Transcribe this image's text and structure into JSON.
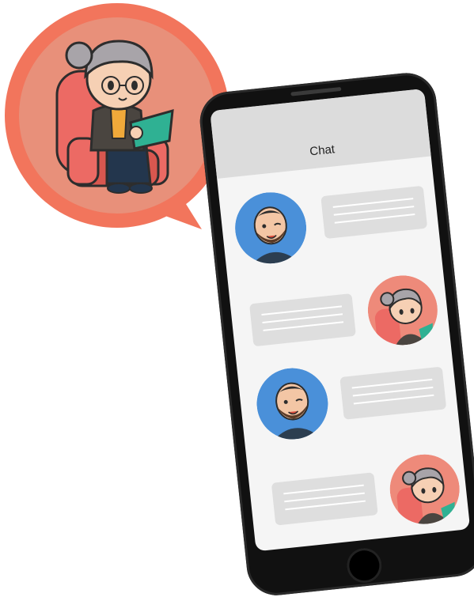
{
  "app": {
    "title": "Chat"
  },
  "messages": [
    {
      "sender": "man",
      "align": "left"
    },
    {
      "sender": "grandma",
      "align": "right"
    },
    {
      "sender": "man",
      "align": "left"
    },
    {
      "sender": "grandma",
      "align": "right"
    }
  ],
  "colors": {
    "callout_outer": "#f2755c",
    "callout_inner": "#e8907a",
    "man_avatar_bg": "#4a90d9",
    "grandma_avatar_bg": "#ee8a7a",
    "bubble": "#dedede",
    "phone_frame": "#111111",
    "screen": "#f5f5f5",
    "header": "#dcdcdc"
  },
  "icons": [
    "speaker-grille",
    "home-button",
    "man-avatar-icon",
    "grandma-reading-icon"
  ]
}
